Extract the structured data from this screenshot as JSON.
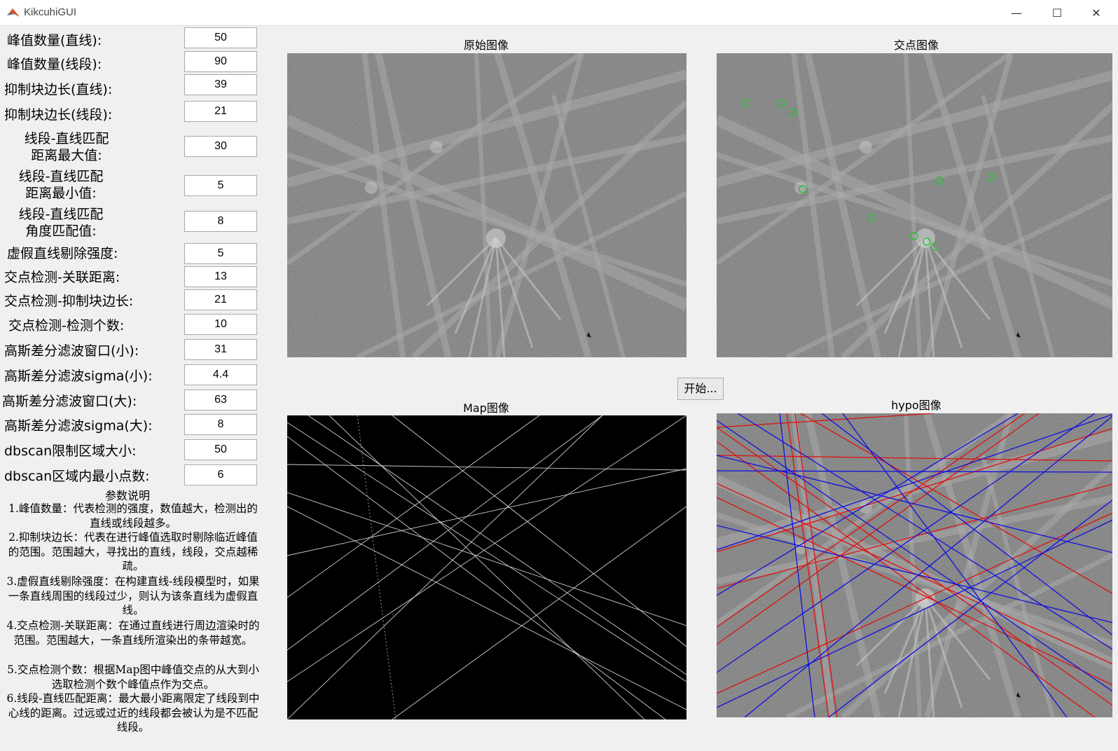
{
  "window": {
    "title": "KikcuhiGUI",
    "minimize": "—",
    "maximize": "☐",
    "close": "✕"
  },
  "params": [
    {
      "label": "峰值数量(直线):",
      "value": "50"
    },
    {
      "label": "峰值数量(线段):",
      "value": "90"
    },
    {
      "label": "抑制块边长(直线):",
      "value": "39"
    },
    {
      "label": "抑制块边长(线段):",
      "value": "21"
    },
    {
      "label": "线段-直线匹配\n距离最大值:",
      "value": "30"
    },
    {
      "label": "线段-直线匹配\n距离最小值:",
      "value": "5"
    },
    {
      "label": "线段-直线匹配\n角度匹配值:",
      "value": "8"
    },
    {
      "label": "虚假直线剔除强度:",
      "value": "5"
    },
    {
      "label": "交点检测-关联距离:",
      "value": "13"
    },
    {
      "label": "交点检测-抑制块边长:",
      "value": "21"
    },
    {
      "label": "交点检测-检测个数:",
      "value": "10"
    },
    {
      "label": "高斯差分滤波窗口(小):",
      "value": "31"
    },
    {
      "label": "高斯差分滤波sigma(小):",
      "value": "4.4"
    },
    {
      "label": "高斯差分滤波窗口(大):",
      "value": "63"
    },
    {
      "label": "高斯差分滤波sigma(大):",
      "value": "8"
    },
    {
      "label": "dbscan限制区域大小:",
      "value": "50"
    },
    {
      "label": "dbscan区域内最小点数:",
      "value": "6"
    }
  ],
  "description": {
    "title": "参数说明",
    "items": [
      "1.峰值数量：代表检测的强度，数值越大，检测出的直线或线段越多。",
      "2.抑制块边长：代表在进行峰值选取时剔除临近峰值的范围。范围越大，寻找出的直线，线段，交点越稀疏。",
      "3.虚假直线剔除强度：在构建直线-线段模型时，如果一条直线周围的线段过少，则认为该条直线为虚假直线。",
      "4.交点检测-关联距离：在通过直线进行周边渲染时的范围。范围越大，一条直线所渲染出的条带越宽。",
      "5.交点检测个数：根据Map图中峰值交点的从大到小选取检测个数个峰值点作为交点。",
      "6.线段-直线匹配距离：最大最小距离限定了线段到中心线的距离。过远或过近的线段都会被认为是不匹配线段。"
    ]
  },
  "panels": {
    "original": "原始图像",
    "intersection": "交点图像",
    "map": "Map图像",
    "hypo": "hypo图像"
  },
  "start_button": "开始...",
  "colors": {
    "accent_green": "#2fbf3a",
    "red_line": "#e01010",
    "blue_line": "#1010e0"
  }
}
